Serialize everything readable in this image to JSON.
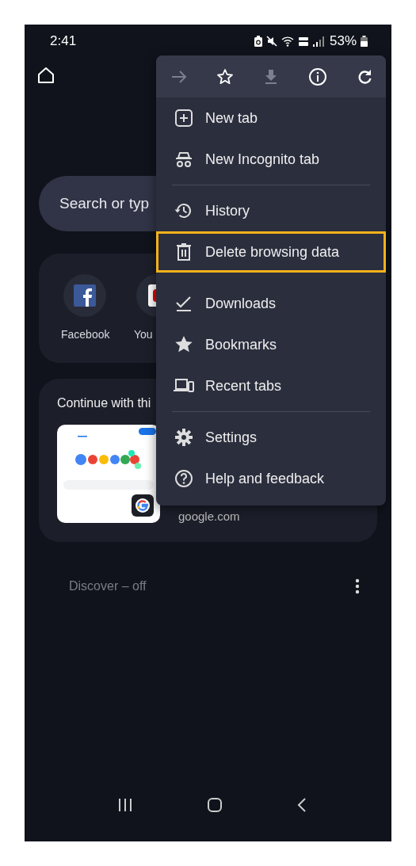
{
  "status_bar": {
    "time": "2:41",
    "battery": "53%"
  },
  "search": {
    "placeholder": "Search or typ"
  },
  "shortcuts": [
    {
      "label": "Facebook",
      "kind": "facebook"
    },
    {
      "label": "You",
      "kind": "youtube"
    }
  ],
  "continue_card": {
    "title": "Continue with thi",
    "site": "google.com"
  },
  "discover": {
    "label": "Discover – off"
  },
  "menu": {
    "toolbar": [
      {
        "kind": "forward",
        "disabled": true
      },
      {
        "kind": "star",
        "disabled": false
      },
      {
        "kind": "download",
        "disabled": true
      },
      {
        "kind": "info",
        "disabled": false
      },
      {
        "kind": "reload",
        "disabled": false
      }
    ],
    "sections": [
      {
        "divider": false,
        "items": [
          {
            "label": "New tab",
            "kind": "new-tab",
            "highlighted": false
          },
          {
            "label": "New Incognito tab",
            "kind": "incognito",
            "highlighted": false
          }
        ]
      },
      {
        "divider": true,
        "items": [
          {
            "label": "History",
            "kind": "history",
            "highlighted": false
          },
          {
            "label": "Delete browsing data",
            "kind": "delete",
            "highlighted": true
          }
        ]
      },
      {
        "divider": false,
        "items": [
          {
            "label": "Downloads",
            "kind": "downloads",
            "highlighted": false
          },
          {
            "label": "Bookmarks",
            "kind": "bookmarks",
            "highlighted": false
          },
          {
            "label": "Recent tabs",
            "kind": "recent",
            "highlighted": false
          }
        ]
      },
      {
        "divider": true,
        "items": [
          {
            "label": "Settings",
            "kind": "settings",
            "highlighted": false
          },
          {
            "label": "Help and feedback",
            "kind": "help",
            "highlighted": false
          }
        ]
      }
    ]
  }
}
